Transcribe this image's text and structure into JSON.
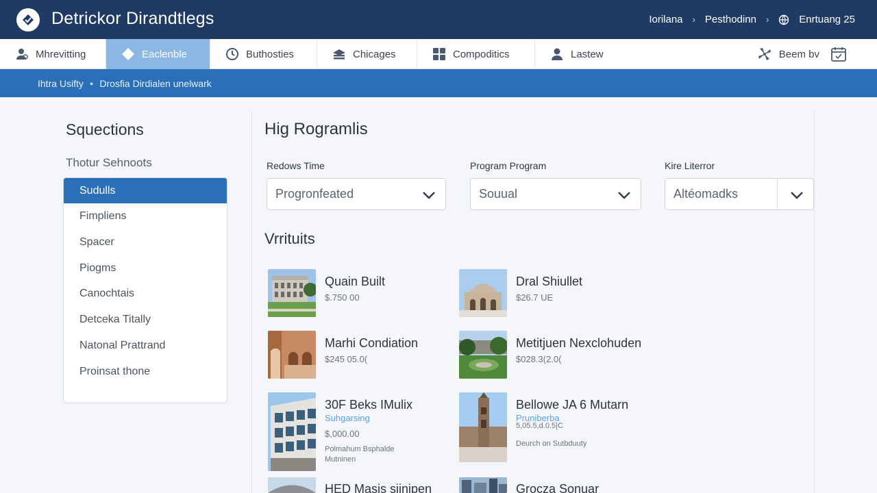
{
  "header": {
    "app_title": "Detrickor Dirandtlegs",
    "nav": [
      "Iorilana",
      "Pesthodinn",
      "Enrtuang 25"
    ]
  },
  "tabs": [
    {
      "label": "Mhrevitting",
      "icon": "user-icon",
      "active": false
    },
    {
      "label": "Eaclenble",
      "icon": "diamond-icon",
      "active": true
    },
    {
      "label": "Buthosties",
      "icon": "clock-icon",
      "active": false
    },
    {
      "label": "Chicages",
      "icon": "stack-icon",
      "active": false
    },
    {
      "label": "Compoditics",
      "icon": "grid-icon",
      "active": false
    },
    {
      "label": "Lastew",
      "icon": "person-icon",
      "active": false
    }
  ],
  "tab_right": {
    "label": "Beem bv",
    "icon": "calendar-icon"
  },
  "breadcrumb": [
    "Ihtra Usifty",
    "Drosfia Dirdialen unelwark"
  ],
  "sidebar": {
    "title": "Squections",
    "subtitle": "Thotur Sehnoots",
    "items": [
      "Sudulls",
      "Fimpliens",
      "Spacer",
      "Piogms",
      "Canochtais",
      "Detceka Titally",
      "Natonal Prattrand",
      "Proinsat thone"
    ],
    "active_index": 0
  },
  "content": {
    "title": "Hig Rogramlis",
    "filters": [
      {
        "label": "Redows Time",
        "value": "Progronfeated"
      },
      {
        "label": "Program Program",
        "value": "Souual"
      },
      {
        "label": "Kire Literror",
        "value": "Altéomadks"
      }
    ],
    "section_title": "Vrrituits"
  },
  "cards": [
    {
      "name": "Quain Built",
      "price": "$.750 00",
      "image": "stone-university-building"
    },
    {
      "name": "Dral Shiullet",
      "price": "$26.7 UE",
      "image": "domed-arch-building"
    },
    {
      "name": "Marhi Condiation",
      "price": "$245 05.0(",
      "image": "brick-arcade-courtyard"
    },
    {
      "name": "Metitjuen Nexclohuden",
      "price": "$028.3(2.0(",
      "image": "garden-with-trees"
    },
    {
      "name": "30F Beks IMulix",
      "tag": "Suhgarsing",
      "price": "$,000.00",
      "note": [
        "Polmahum Bsphalde",
        "Mutninen"
      ],
      "image": "modern-glass-building"
    },
    {
      "name": "Bellowe JA 6 Mutarn",
      "tag": "Pruniberba",
      "price": "5,05.5,d.0.5|C",
      "note": [
        "Deurch on Sutbduuty"
      ],
      "image": "church-tower-plaza"
    },
    {
      "name": "HED Masis siinipen",
      "image": "city-rooftop"
    },
    {
      "name": "Grocza Sonuar",
      "image": "city-skyline"
    }
  ]
}
